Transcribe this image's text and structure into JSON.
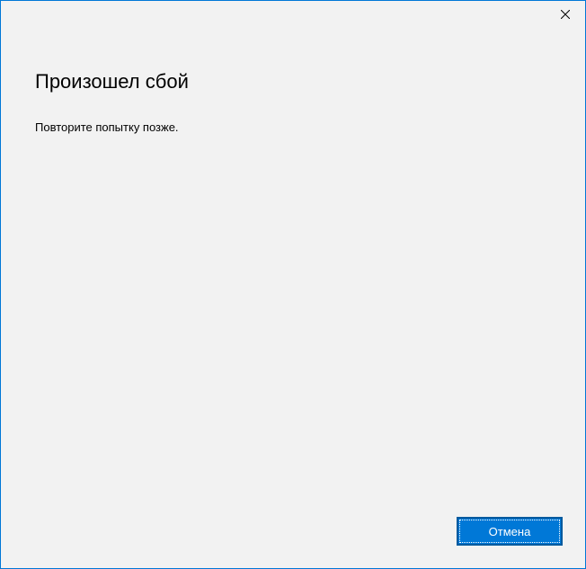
{
  "dialog": {
    "heading": "Произошел сбой",
    "message": "Повторите попытку позже."
  },
  "buttons": {
    "cancel": "Отмена"
  }
}
